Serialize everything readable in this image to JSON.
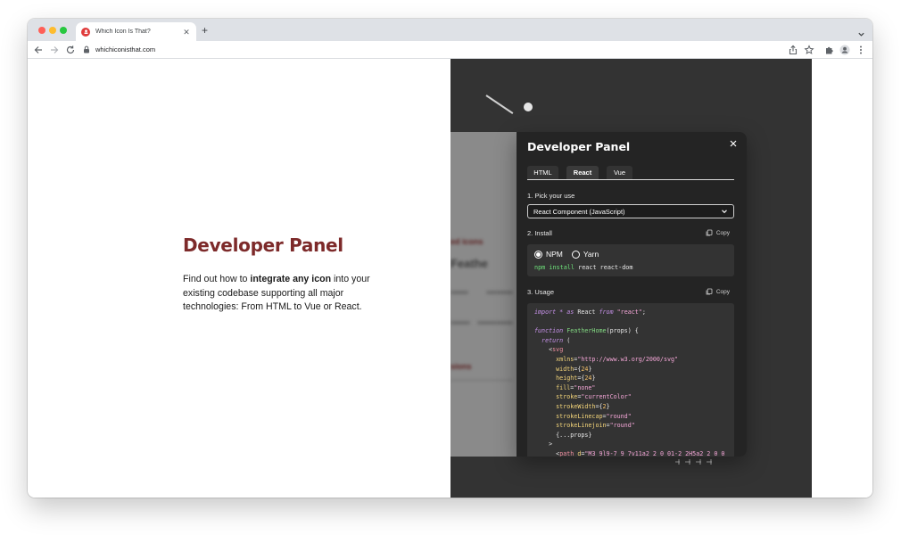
{
  "browser": {
    "tab_title": "Which Icon Is That?",
    "url": "whichiconisthat.com"
  },
  "hero": {
    "title": "Developer Panel",
    "desc_before": "Find out how to ",
    "desc_bold": "integrate any icon",
    "desc_after": " into your existing codebase supporting all major technologies: From HTML to Vue or React."
  },
  "background_preview": {
    "label_1": "ed icons",
    "logo": "Feathe",
    "label_2": "sions"
  },
  "panel": {
    "title": "Developer Panel",
    "tabs": [
      {
        "label": "HTML",
        "active": false
      },
      {
        "label": "React",
        "active": true
      },
      {
        "label": "Vue",
        "active": false
      }
    ],
    "step1_label": "1. Pick your use",
    "select_value": "React Component (JavaScript)",
    "step2_label": "2. Install",
    "copy_label": "Copy",
    "install": {
      "options": [
        {
          "label": "NPM",
          "checked": true
        },
        {
          "label": "Yarn",
          "checked": false
        }
      ],
      "command_prefix": "npm install",
      "command_args": " react react-dom"
    },
    "step3_label": "3. Usage",
    "code_lines": [
      [
        {
          "t": "import * as ",
          "c": "kw"
        },
        {
          "t": "React ",
          "c": ""
        },
        {
          "t": "from ",
          "c": "kw"
        },
        {
          "t": "\"react\"",
          "c": "st"
        },
        {
          "t": ";",
          "c": ""
        }
      ],
      [
        {
          "t": "",
          "c": ""
        }
      ],
      [
        {
          "t": "function ",
          "c": "kw"
        },
        {
          "t": "FeatherHome",
          "c": "fn"
        },
        {
          "t": "(props) {",
          "c": ""
        }
      ],
      [
        {
          "t": "  return ",
          "c": "kw"
        },
        {
          "t": "(",
          "c": ""
        }
      ],
      [
        {
          "t": "    <",
          "c": ""
        },
        {
          "t": "svg",
          "c": "tg"
        }
      ],
      [
        {
          "t": "      xmlns",
          "c": "at"
        },
        {
          "t": "=",
          "c": ""
        },
        {
          "t": "\"http://www.w3.org/2000/svg\"",
          "c": "st"
        }
      ],
      [
        {
          "t": "      width",
          "c": "at"
        },
        {
          "t": "={",
          "c": ""
        },
        {
          "t": "24",
          "c": "nu"
        },
        {
          "t": "}",
          "c": ""
        }
      ],
      [
        {
          "t": "      height",
          "c": "at"
        },
        {
          "t": "={",
          "c": ""
        },
        {
          "t": "24",
          "c": "nu"
        },
        {
          "t": "}",
          "c": ""
        }
      ],
      [
        {
          "t": "      fill",
          "c": "at"
        },
        {
          "t": "=",
          "c": ""
        },
        {
          "t": "\"none\"",
          "c": "st"
        }
      ],
      [
        {
          "t": "      stroke",
          "c": "at"
        },
        {
          "t": "=",
          "c": ""
        },
        {
          "t": "\"currentColor\"",
          "c": "st"
        }
      ],
      [
        {
          "t": "      strokeWidth",
          "c": "at"
        },
        {
          "t": "={",
          "c": ""
        },
        {
          "t": "2",
          "c": "nu"
        },
        {
          "t": "}",
          "c": ""
        }
      ],
      [
        {
          "t": "      strokeLinecap",
          "c": "at"
        },
        {
          "t": "=",
          "c": ""
        },
        {
          "t": "\"round\"",
          "c": "st"
        }
      ],
      [
        {
          "t": "      strokeLinejoin",
          "c": "at"
        },
        {
          "t": "=",
          "c": ""
        },
        {
          "t": "\"round\"",
          "c": "st"
        }
      ],
      [
        {
          "t": "      {...props}",
          "c": ""
        }
      ],
      [
        {
          "t": "    >",
          "c": ""
        }
      ],
      [
        {
          "t": "      <",
          "c": ""
        },
        {
          "t": "path ",
          "c": "tg"
        },
        {
          "t": "d",
          "c": "at"
        },
        {
          "t": "=",
          "c": ""
        },
        {
          "t": "\"M3 9l9-7 9 7v11a2 2 0 01-2 2H5a2 2 0 0",
          "c": "st"
        }
      ]
    ]
  },
  "colors": {
    "accent": "#7d2a2a",
    "dark_bg": "#333333",
    "panel_bg": "#242424"
  }
}
